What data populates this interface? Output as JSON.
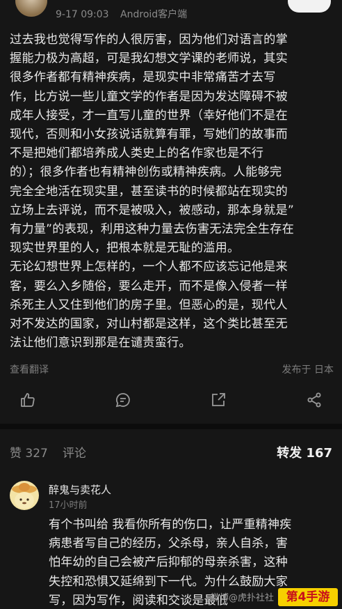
{
  "post": {
    "date": "9-17 09:03",
    "client": "Android客户端",
    "lines": [
      "过去我也觉得写作的人很厉害，因为他们对语言的掌",
      "握能力极为高超，可是我幻想文学课的老师说，其实",
      "很多作者都有精神疾病，是现实中非常痛苦才去写",
      "作，比方说一些儿童文学的作者是因为发达障碍不被",
      "成年人接受，才一直写儿童的世界（幸好他们不是在",
      "现代，否则和小女孩说话就算有罪，写她们的故事而",
      "不是把她们都培养成人类史上的名作家也是不行",
      "的）；很多作者也有精神创伤或精神疾病。人能够完",
      "完全全地活在现实里，甚至读书的时候都站在现实的",
      "立场上去评说，而不是被吸入，被感动，那本身就是”",
      "有力量”的表现，利用这种力量去伤害无法完全生存在",
      "现实世界里的人，把根本就是无耻的滥用。",
      "无论幻想世界上怎样的，一个人都不应该忘记他是来",
      "客，要么入乡随俗，要么走开，而不是像入侵者一样",
      "杀死主人又住到他们的房子里。但恶心的是，现代人",
      "对不发达的国家，对山村都是这样，这个类比甚至无",
      "法让他们意识到那是在谴责蛮行。"
    ],
    "translate_label": "查看翻译",
    "location": "发布于 日本"
  },
  "actions": {
    "icons": [
      "thumbs-up-icon",
      "comment-icon",
      "share-icon",
      "more-share-icon"
    ]
  },
  "tabs": {
    "likes": "赞 327",
    "comments": "评论",
    "reposts": "转发 167"
  },
  "comment": {
    "name": "醉鬼与卖花人",
    "time": "17小时前",
    "lines": [
      "有个书叫给 我看你所有的伤口，让严重精神疾",
      "病患者写自己的经历，父杀母，亲人自杀，害",
      "怕年幼的自己会被产后抑郁的母亲杀害，这种",
      "失控和恐惧又延绵到下一代。为什么鼓励大家",
      "写，因为写作，阅读和交谈是最低"
    ]
  },
  "watermark": {
    "text": "微博@虎扑社社",
    "logo": "第4手游"
  },
  "colors": {
    "background": "#161616",
    "text": "#e8e8e8",
    "muted": "#8a8a8a",
    "watermark_bg": "#f6d000",
    "watermark_fg": "#c8101a"
  }
}
